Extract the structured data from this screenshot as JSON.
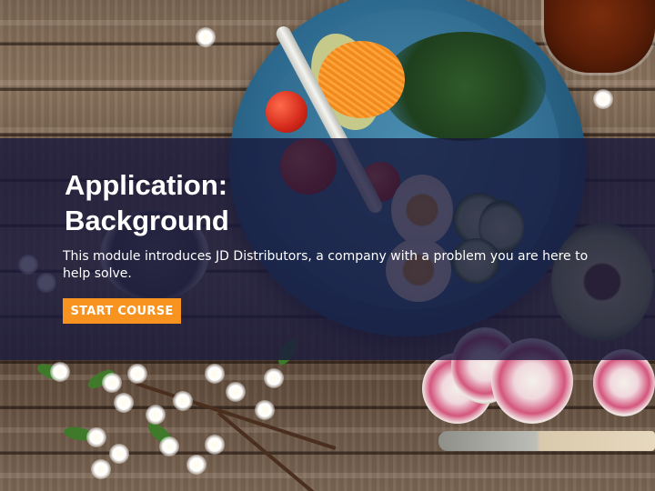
{
  "module": {
    "title_line1": "Application:",
    "title_line2": "Background",
    "description": "This module introduces JD Distributors, a company with a problem you are here to help solve.",
    "start_button_label": "START COURSE"
  },
  "colors": {
    "overlay": "#18183c",
    "button": "#f7931e",
    "text": "#ffffff"
  },
  "background": {
    "image_subject": "food-bowl-on-wooden-table"
  }
}
